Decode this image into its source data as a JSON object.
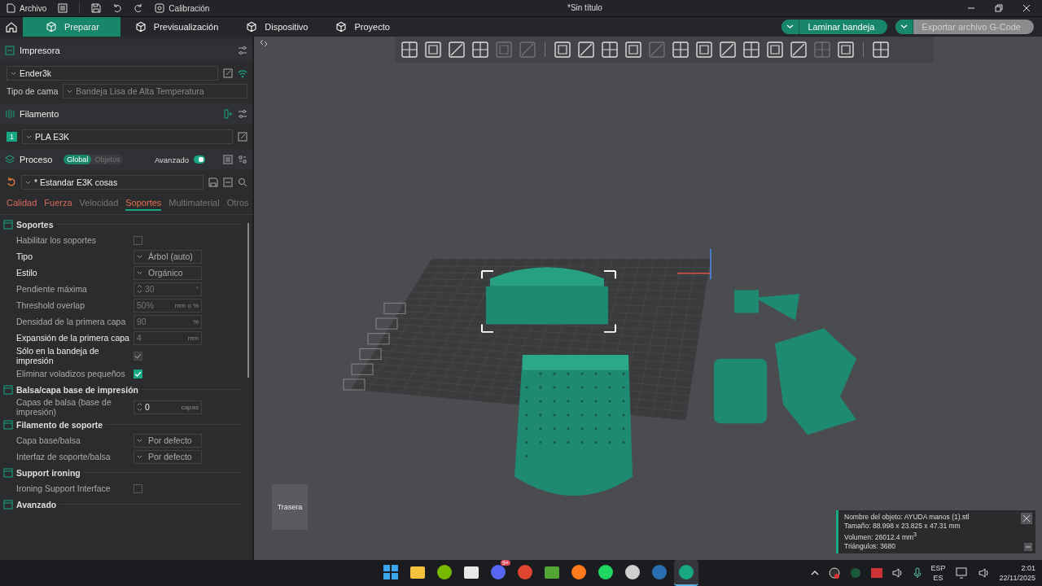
{
  "title_bar": {
    "menu": [
      "Archivo",
      "Calibración"
    ],
    "title": "*Sin título"
  },
  "nav": {
    "tabs": [
      {
        "label": "Preparar",
        "selected": true
      },
      {
        "label": "Previsualización",
        "selected": false
      },
      {
        "label": "Dispositivo",
        "selected": false
      },
      {
        "label": "Proyecto",
        "selected": false
      }
    ],
    "actions": [
      {
        "label": "Laminar bandeja",
        "disabled": false
      },
      {
        "label": "Exportar archivo G-Code",
        "disabled": true
      }
    ]
  },
  "sidebar": {
    "printer": {
      "title": "Impresora",
      "name": "Ender3k",
      "bed_label": "Tipo de cama",
      "bed": "Bandeja Lisa de Alta Temperatura"
    },
    "filament": {
      "title": "Filamento",
      "slot": "1",
      "name": "PLA E3K"
    },
    "process": {
      "title": "Proceso",
      "scope": [
        {
          "label": "Global",
          "selected": true
        },
        {
          "label": "Objetos",
          "selected": false
        }
      ],
      "advanced_label": "Avanzado",
      "advanced": true,
      "preset": "* Estandar E3K cosas"
    },
    "tabs": [
      {
        "label": "Calidad",
        "selected": false,
        "modified": true
      },
      {
        "label": "Fuerza",
        "selected": false,
        "modified": true
      },
      {
        "label": "Velocidad",
        "selected": false,
        "modified": false
      },
      {
        "label": "Soportes",
        "selected": true,
        "modified": false
      },
      {
        "label": "Multimaterial",
        "selected": false,
        "modified": false
      },
      {
        "label": "Otros",
        "selected": false,
        "modified": false
      }
    ],
    "groups": [
      {
        "title": "Soportes",
        "rows": [
          {
            "label": "Habilitar los soportes",
            "kind": "check",
            "checked": false,
            "disabled": false,
            "emphasized": false
          },
          {
            "label": "Tipo",
            "kind": "select",
            "value": "Árbol (auto)",
            "emphasized": true
          },
          {
            "label": "Estilo",
            "kind": "select",
            "value": "Orgánico",
            "emphasized": true
          },
          {
            "label": "Pendiente máxima",
            "kind": "spin",
            "value": "30",
            "unit": "°",
            "disabled": true,
            "emphasized": false
          },
          {
            "label": "Threshold overlap",
            "kind": "input",
            "value": "50%",
            "unit": "mm o %",
            "disabled": true,
            "emphasized": false
          },
          {
            "label": "Densidad de la primera capa",
            "kind": "input",
            "value": "90",
            "unit": "%",
            "disabled": true,
            "emphasized": false
          },
          {
            "label": "Expansión de la primera capa",
            "kind": "input",
            "value": "4",
            "unit": "mm",
            "disabled": true,
            "emphasized": true
          },
          {
            "label": "Sólo en la bandeja de impresión",
            "kind": "check",
            "checked": true,
            "disabled": true,
            "emphasized": true
          },
          {
            "label": "Eliminar voladizos pequeños",
            "kind": "check",
            "checked": true,
            "disabled": false,
            "emphasized": false
          }
        ]
      },
      {
        "title": "Balsa/capa base de impresión",
        "rows": [
          {
            "label": "Capas de balsa (base de impresión)",
            "kind": "spin",
            "value": "0",
            "unit": "capas",
            "disabled": false,
            "emphasized": false
          }
        ]
      },
      {
        "title": "Filamento de soporte",
        "rows": [
          {
            "label": "Capa base/balsa",
            "kind": "select",
            "value": "Por defecto",
            "emphasized": false
          },
          {
            "label": "Interfaz de soporte/balsa",
            "kind": "select",
            "value": "Por defecto",
            "emphasized": false
          }
        ]
      },
      {
        "title": "Support ironing",
        "rows": [
          {
            "label": "Ironing Support Interface",
            "kind": "check",
            "checked": false,
            "disabled": false,
            "emphasized": false
          }
        ]
      },
      {
        "title": "Avanzado"
      }
    ]
  },
  "viewport": {
    "view_cube_label": "Trasera",
    "object_info": [
      "Nombre del objeto: AYUDA manos (1).stl",
      "Tamaño: 88.998 x 23.825 x 47.31 mm",
      "Volumen: 26012.4 mm$^{3}$",
      "Triángulos: 3680"
    ]
  },
  "taskbar": {
    "apps": [
      {
        "kind": "start",
        "active": false
      },
      {
        "kind": "folder",
        "active": false
      },
      {
        "kind": "gpu",
        "active": false
      },
      {
        "kind": "store",
        "active": false
      },
      {
        "kind": "chat",
        "active": false,
        "badge": "9+"
      },
      {
        "kind": "browser",
        "active": false
      },
      {
        "kind": "game",
        "active": false
      },
      {
        "kind": "firefox",
        "active": false
      },
      {
        "kind": "music",
        "active": false
      },
      {
        "kind": "record",
        "active": false
      },
      {
        "kind": "steam",
        "active": false
      },
      {
        "kind": "slicer",
        "active": true
      }
    ],
    "language": [
      "ESP",
      "ES"
    ],
    "time": "2:01",
    "date": "22/11/2025"
  }
}
